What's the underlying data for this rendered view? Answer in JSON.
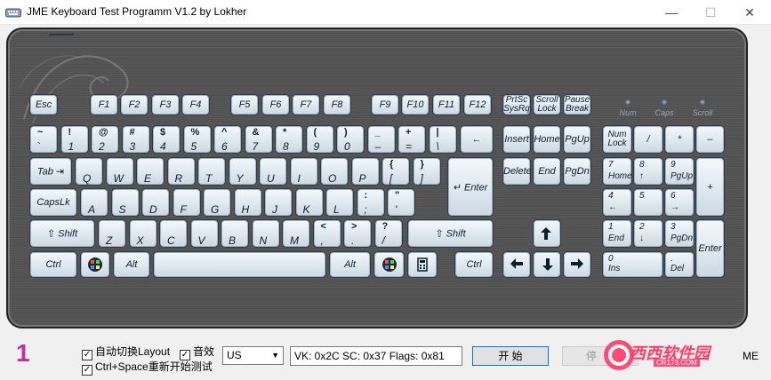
{
  "window": {
    "title": "JME Keyboard Test Programm V1.2 by Lokher",
    "minimize": "—",
    "maximize": "☐",
    "close": "✕"
  },
  "leds": [
    {
      "label": "Num"
    },
    {
      "label": "Caps"
    },
    {
      "label": "Scroll"
    }
  ],
  "media_keys": [
    {
      "name": "back-key",
      "icon": "arrow-left-icon"
    },
    {
      "name": "forward-key",
      "icon": "arrow-right-icon"
    },
    {
      "name": "refresh-key",
      "icon": "refresh-icon"
    },
    {
      "name": "stop-key",
      "icon": "x-icon"
    },
    {
      "name": "search-key",
      "icon": "magnifier-icon"
    },
    {
      "name": "favorites-key",
      "icon": "star-icon"
    },
    {
      "name": "home-page-key",
      "icon": "house-icon"
    },
    {
      "name": "my-computer-key",
      "icon": "monitor-icon"
    },
    {
      "name": "mail-key",
      "icon": "envelope-icon"
    },
    {
      "name": "calculator-key",
      "icon": "calculator-icon"
    },
    {
      "name": "media-select-key",
      "icon": "music-note-icon"
    },
    {
      "name": "play-pause-key",
      "icon": "play-pause-icon"
    },
    {
      "name": "media-stop-key",
      "icon": "square-stop-icon"
    },
    {
      "name": "prev-track-key",
      "icon": "previous-track-icon"
    },
    {
      "name": "next-track-key",
      "icon": "next-track-icon"
    },
    {
      "name": "mute-key",
      "icon": "mute-icon"
    },
    {
      "name": "volume-down-key",
      "icon": "volume-down-icon"
    },
    {
      "name": "volume-up-key",
      "icon": "volume-up-icon"
    }
  ],
  "keys": {
    "esc": "Esc",
    "f": [
      "F1",
      "F2",
      "F3",
      "F4",
      "F5",
      "F6",
      "F7",
      "F8",
      "F9",
      "F10",
      "F11",
      "F12"
    ],
    "prtsc": [
      "PrtSc",
      "SysRq"
    ],
    "scroll": [
      "Scroll",
      "Lock"
    ],
    "pause": [
      "Pause",
      "Break"
    ],
    "num_row": [
      [
        "~",
        "`"
      ],
      [
        "!",
        "1"
      ],
      [
        "@",
        "2"
      ],
      [
        "#",
        "3"
      ],
      [
        "$",
        "4"
      ],
      [
        "%",
        "5"
      ],
      [
        "^",
        "6"
      ],
      [
        "&",
        "7"
      ],
      [
        "*",
        "8"
      ],
      [
        "(",
        "9"
      ],
      [
        ")",
        "0"
      ],
      [
        "_",
        "–"
      ],
      [
        "+",
        "="
      ],
      [
        "|",
        "\\"
      ]
    ],
    "backspace": "←",
    "tab": "Tab",
    "row_q": [
      [
        "",
        "Q"
      ],
      [
        "",
        "W"
      ],
      [
        "",
        "E"
      ],
      [
        "",
        "R"
      ],
      [
        "",
        "T"
      ],
      [
        "",
        "Y"
      ],
      [
        "",
        "U"
      ],
      [
        "",
        "I"
      ],
      [
        "",
        "O"
      ],
      [
        "",
        "P"
      ],
      [
        "{",
        "["
      ],
      [
        "}",
        "]"
      ]
    ],
    "capslock": "CapsLk",
    "row_a": [
      [
        "",
        "A"
      ],
      [
        "",
        "S"
      ],
      [
        "",
        "D"
      ],
      [
        "",
        "F"
      ],
      [
        "",
        "G"
      ],
      [
        "",
        "H"
      ],
      [
        "",
        "J"
      ],
      [
        "",
        "K"
      ],
      [
        "",
        "L"
      ],
      [
        ":",
        ";"
      ],
      [
        "\"",
        "'"
      ]
    ],
    "enter": "Enter",
    "shift": "Shift",
    "row_z": [
      [
        "",
        "Z"
      ],
      [
        "",
        "X"
      ],
      [
        "",
        "C"
      ],
      [
        "",
        "V"
      ],
      [
        "",
        "B"
      ],
      [
        "",
        "N"
      ],
      [
        "",
        "M"
      ],
      [
        "<",
        ","
      ],
      [
        ">",
        "."
      ],
      [
        "?",
        "/"
      ]
    ],
    "ctrl": "Ctrl",
    "alt": "Alt",
    "nav": {
      "insert": "Insert",
      "home": "Home",
      "pgup": "PgUp",
      "delete": "Delete",
      "end": "End",
      "pgdn": "PgDn"
    },
    "numpad": {
      "numlock": [
        "Num",
        "Lock"
      ],
      "div": "/",
      "mul": "*",
      "sub": "–",
      "add": "+",
      "enter": "Enter",
      "n7": [
        "7",
        "Home"
      ],
      "n8": [
        "8",
        "↑"
      ],
      "n9": [
        "9",
        "PgUp"
      ],
      "n4": [
        "4",
        "←"
      ],
      "n5": [
        "5",
        ""
      ],
      "n6": [
        "6",
        "→"
      ],
      "n1": [
        "1",
        "End"
      ],
      "n2": [
        "2",
        "↓"
      ],
      "n3": [
        "3",
        "PgDn"
      ],
      "n0": [
        "0",
        "Ins"
      ],
      "dot": [
        ".",
        "Del"
      ]
    }
  },
  "bottom": {
    "counter": "1",
    "auto_layout": {
      "label": "自动切换Layout",
      "checked": true
    },
    "sound": {
      "label": "音效",
      "checked": true
    },
    "ctrl_space": {
      "label": "Ctrl+Space重新开始测试",
      "checked": true
    },
    "layout_value": "US",
    "status": "VK: 0x2C  SC: 0x37  Flags: 0x81",
    "start_label": "开 始",
    "stop_label": "停",
    "watermark_text": "西西软件园",
    "watermark_sub": "CR173.COM",
    "me_text": "ME"
  },
  "colors": {
    "accent": "#c0309a",
    "key_face": "#dfe8ef",
    "case": "#505050"
  }
}
